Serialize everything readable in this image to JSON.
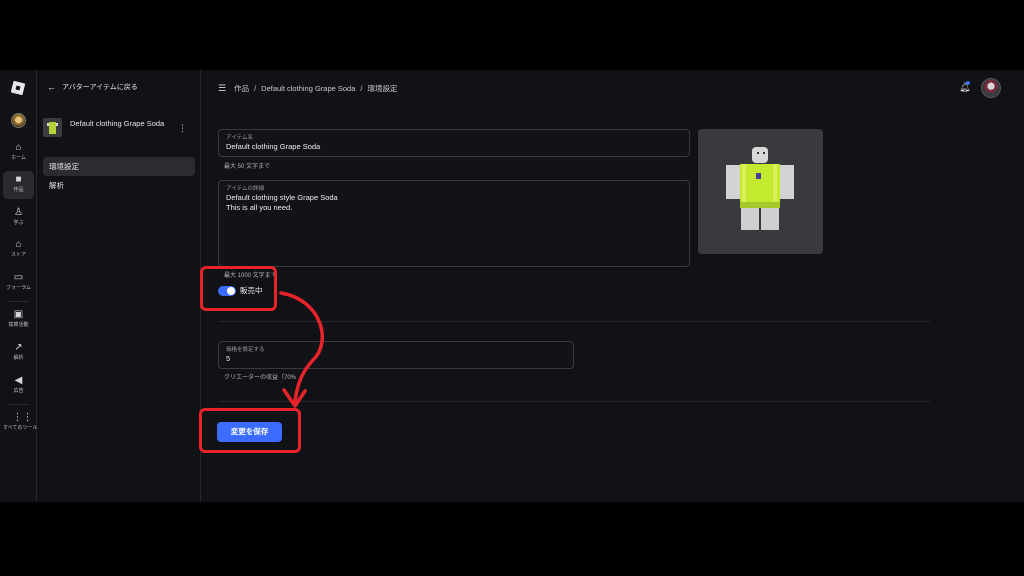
{
  "rail": {
    "items": [
      {
        "label": "ホーム",
        "icon": "home-icon"
      },
      {
        "label": "作品",
        "icon": "creations-icon"
      },
      {
        "label": "学ぶ",
        "icon": "learn-icon"
      },
      {
        "label": "ストア",
        "icon": "store-icon"
      },
      {
        "label": "フォーラム",
        "icon": "forum-icon"
      },
      {
        "label": "換算活動",
        "icon": "wallet-icon"
      },
      {
        "label": "解析",
        "icon": "analytics-icon"
      },
      {
        "label": "広告",
        "icon": "ads-icon"
      },
      {
        "label": "すべてのツール",
        "icon": "grid-icon"
      }
    ]
  },
  "sidebar": {
    "back_label": "アバターアイテムに戻る",
    "item_name": "Default clothing Grape Soda",
    "nav": [
      {
        "label": "環境設定",
        "active": true
      },
      {
        "label": "解析",
        "active": false
      }
    ]
  },
  "breadcrumb": {
    "items": [
      "作品",
      "Default clothing Grape Soda",
      "環境設定"
    ],
    "separator": "/"
  },
  "form": {
    "name": {
      "label": "アイテム名",
      "value": "Default clothing Grape Soda",
      "hint": "最大 50 文字まで"
    },
    "description": {
      "label": "アイテムの詳細",
      "value": "Default clothing style Grape Soda\nThis is all you need.",
      "hint": "最大 1000 文字まで"
    },
    "on_sale": {
      "label": "販売中",
      "checked": true
    },
    "price": {
      "label": "価格を設定する",
      "value": "5",
      "hint": "クリエーターの収益（70%"
    },
    "save_label": "変更を保存"
  },
  "colors": {
    "accent": "#3b6cff",
    "annotation": "#e8232a",
    "background": "#111216"
  }
}
